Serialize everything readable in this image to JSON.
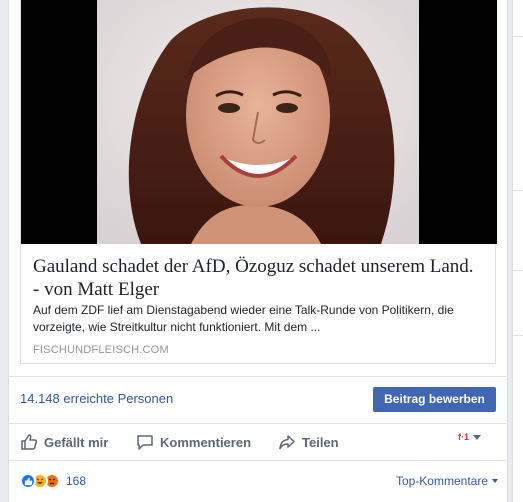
{
  "link": {
    "title": "Gauland schadet der AfD, Özoguz schadet unserem Land. - von Matt Elger",
    "description": "Auf dem ZDF lief am Dienstagabend wieder eine Talk-Runde von Politikern, die vorzeigte, wie Streitkultur nicht funktioniert. Mit dem ...",
    "domain": "FISCHUNDFLEISCH.COM"
  },
  "stats": {
    "reach": "14.148 erreichte Personen",
    "boost_label": "Beitrag bewerben"
  },
  "actions": {
    "like_label": "Gefällt mir",
    "comment_label": "Kommentieren",
    "share_label": "Teilen"
  },
  "reactions": {
    "count": "168",
    "sort_label": "Top-Kommentare"
  },
  "colors": {
    "link_blue": "#365899",
    "button_blue": "#4267b2",
    "action_gray": "#606770",
    "like_blue": "#1877f2",
    "haha_yellow": "#f7b125",
    "angry_orange": "#e9710f"
  },
  "icons": [
    "like-icon",
    "comment-icon",
    "share-icon",
    "like-reaction-icon",
    "haha-reaction-icon",
    "angry-reaction-icon"
  ]
}
